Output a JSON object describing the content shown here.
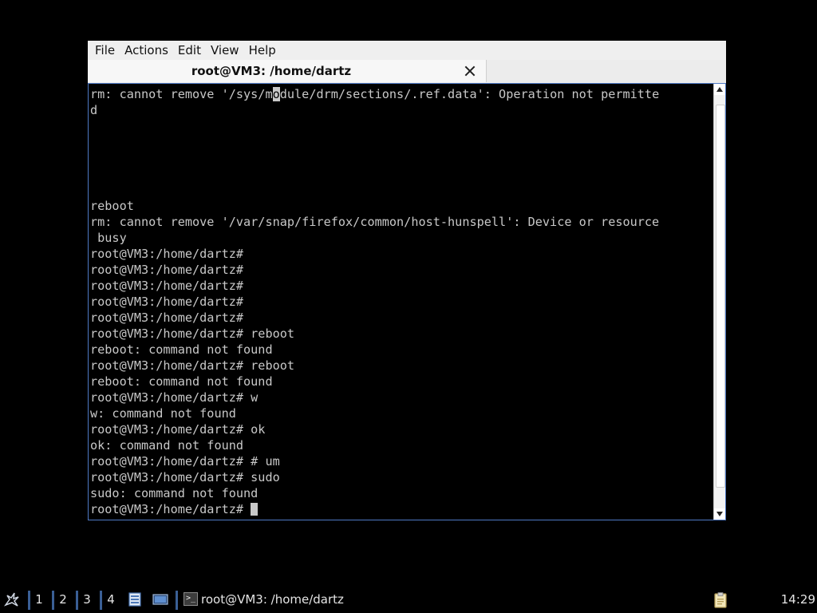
{
  "window": {
    "menu": [
      "File",
      "Actions",
      "Edit",
      "View",
      "Help"
    ],
    "tab_title": "root@VM3: /home/dartz"
  },
  "terminal": {
    "lines": [
      "rm: cannot remove '/sys/module/drm/sections/.ref.data': Operation not permitte",
      "d",
      "",
      "",
      "",
      "",
      "",
      "reboot",
      "rm: cannot remove '/var/snap/firefox/common/host-hunspell': Device or resource",
      " busy",
      "root@VM3:/home/dartz#",
      "root@VM3:/home/dartz#",
      "root@VM3:/home/dartz#",
      "root@VM3:/home/dartz#",
      "root@VM3:/home/dartz#",
      "root@VM3:/home/dartz# reboot",
      "reboot: command not found",
      "root@VM3:/home/dartz# reboot",
      "reboot: command not found",
      "root@VM3:/home/dartz# w",
      "w: command not found",
      "root@VM3:/home/dartz# ok",
      "ok: command not found",
      "root@VM3:/home/dartz# # um",
      "root@VM3:/home/dartz# sudo",
      "sudo: command not found",
      "root@VM3:/home/dartz# "
    ],
    "selection": {
      "line": 0,
      "char": 25
    }
  },
  "taskbar": {
    "start_icon": "start-menu-icon",
    "workspaces": [
      "1",
      "2",
      "3",
      "4"
    ],
    "launchers": [
      "file-manager-icon",
      "show-desktop-icon"
    ],
    "task_label": "root@VM3: /home/dartz",
    "task_icon": "terminal-icon",
    "tray_icon": "clipboard-icon",
    "clock": "14:29"
  },
  "colors": {
    "terminal_bg": "#000000",
    "terminal_fg": "#c8c8c8",
    "window_border": "#4f79c4",
    "taskbar_separator": "#3a5f95"
  }
}
